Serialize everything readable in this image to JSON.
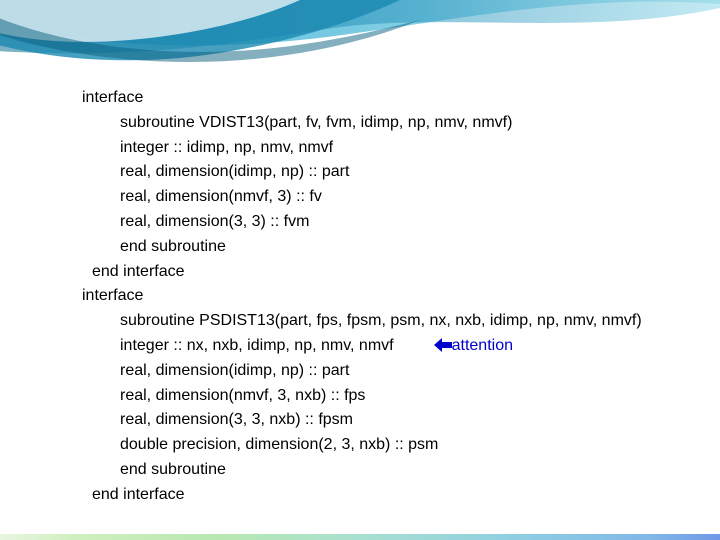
{
  "block1": {
    "l1": "interface",
    "l2": "subroutine VDIST13(part, fv, fvm, idimp, np, nmv, nmvf)",
    "l3": "integer :: idimp, np, nmv, nmvf",
    "l4": "real, dimension(idimp, np) :: part",
    "l5": "real, dimension(nmvf, 3) :: fv",
    "l6": "real, dimension(3, 3) :: fvm",
    "l7": "end subroutine",
    "l8": "end interface"
  },
  "block2": {
    "l1": "interface",
    "l2": "subroutine PSDIST13(part, fps, fpsm, psm, nx, nxb, idimp, np, nmv, nmvf)",
    "l3a": "integer :: nx, nxb, idimp, np, nmv, nmvf",
    "l3arrow": "ç",
    "l3b": "attention",
    "l4": "real, dimension(idimp, np) :: part",
    "l5": "real, dimension(nmvf, 3, nxb) :: fps",
    "l6": "real, dimension(3, 3, nxb) :: fpsm",
    "l7": "double precision, dimension(2, 3, nxb) :: psm",
    "l8": "end subroutine",
    "l9": "end interface"
  }
}
